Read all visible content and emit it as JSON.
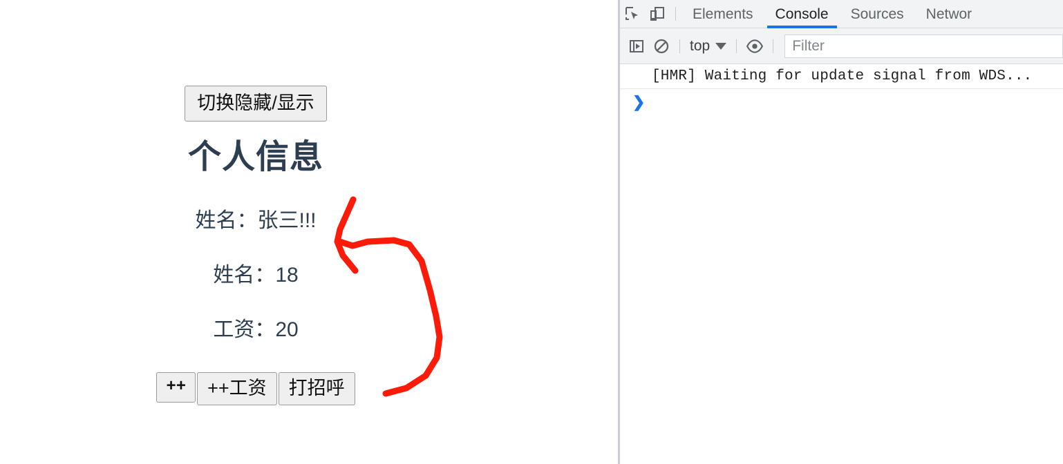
{
  "page": {
    "toggle_button": "切换隐藏/显示",
    "title": "个人信息",
    "rows": [
      {
        "label": "姓名：",
        "value": "张三!!!"
      },
      {
        "label": "姓名：",
        "value": "18"
      },
      {
        "label": "工资：",
        "value": "20"
      }
    ],
    "actions": [
      {
        "label": "++"
      },
      {
        "label": "++工资"
      },
      {
        "label": "打招呼"
      }
    ],
    "annotation": {
      "type": "hand-drawn-arrow",
      "color": "#fb1b08"
    }
  },
  "devtools": {
    "icons": {
      "inspect": "inspect-element-icon",
      "device": "device-toolbar-icon",
      "sidebar": "console-sidebar-icon",
      "clear": "clear-console-icon",
      "eye": "live-expression-icon"
    },
    "tabs": [
      {
        "label": "Elements",
        "active": false
      },
      {
        "label": "Console",
        "active": true
      },
      {
        "label": "Sources",
        "active": false
      },
      {
        "label": "Networ",
        "active": false
      }
    ],
    "toolbar": {
      "context": "top",
      "filter_placeholder": "Filter",
      "filter_value": ""
    },
    "console": {
      "messages": [
        "[HMR] Waiting for update signal from WDS..."
      ],
      "prompt": "❯"
    },
    "accent_color": "#1a73e8",
    "chrome_bg": "#f1f3f4"
  }
}
